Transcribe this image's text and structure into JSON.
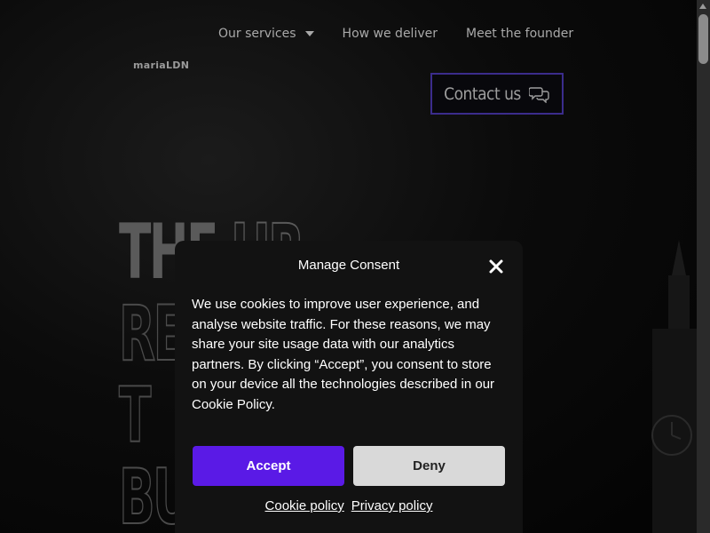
{
  "nav": {
    "items": [
      {
        "label": "Our services",
        "has_dropdown": true
      },
      {
        "label": "How we deliver",
        "has_dropdown": false
      },
      {
        "label": "Meet the founder",
        "has_dropdown": false
      }
    ]
  },
  "logo": {
    "text": "mariaLDN"
  },
  "header": {
    "contact_label": "Contact us",
    "contact_icon": "chat-bubbles-icon",
    "contact_border_color": "#3b2c8c"
  },
  "hero": {
    "line1_solid": "THE",
    "line1_outline": "HR",
    "line2": "RE",
    "line3": "T",
    "line4": "BU"
  },
  "consent": {
    "title": "Manage Consent",
    "body": "We use cookies to improve user experience, and analyse website traffic. For these reasons, we may share your site usage data with our analytics partners. By clicking “Accept”, you consent to store on your device all the technologies described in our Cookie Policy.",
    "accept_label": "Accept",
    "deny_label": "Deny",
    "cookie_policy_label": "Cookie policy",
    "privacy_policy_label": "Privacy policy",
    "accept_color": "#5a1ae6",
    "deny_color": "#d9d9d9"
  }
}
